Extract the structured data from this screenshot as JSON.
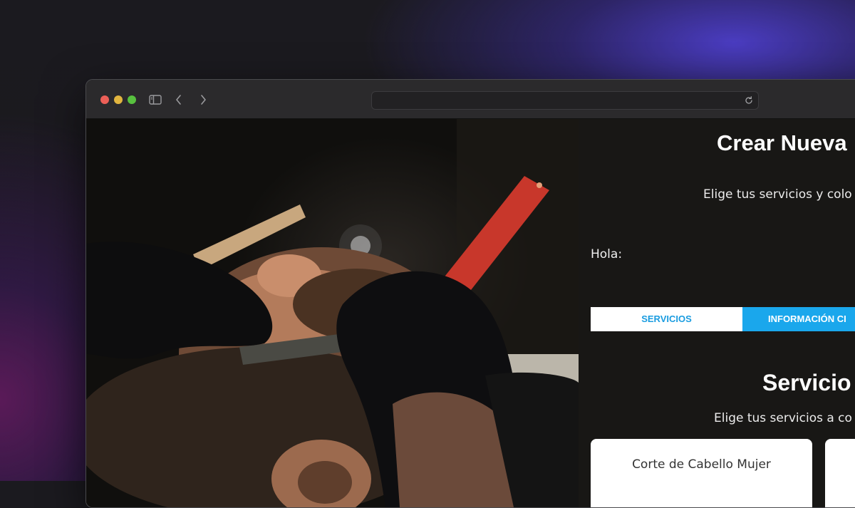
{
  "browser": {
    "address": "",
    "icons": {
      "sidebar": "sidebar-icon",
      "back": "chevron-left-icon",
      "forward": "chevron-right-icon",
      "reload": "reload-icon"
    }
  },
  "hero_image": {
    "subject": "barber-shaving-photo"
  },
  "booking": {
    "title": "Crear Nueva",
    "subtitle": "Elige tus servicios y colo",
    "greeting": "Hola:",
    "tabs": [
      {
        "label": "SERVICIOS",
        "active": true
      },
      {
        "label": "INFORMACIÓN CI",
        "active": false
      }
    ],
    "services_section": {
      "title": "Servicio",
      "subtitle": "Elige tus servicios a co",
      "cards": [
        {
          "label": "Corte de Cabello Mujer"
        },
        {
          "label": ""
        }
      ]
    }
  },
  "colors": {
    "tab_active_bg": "#ffffff",
    "tab_active_text": "#1a9ce0",
    "tab_inactive_bg": "#1aa7ec",
    "page_bg": "#181715"
  }
}
